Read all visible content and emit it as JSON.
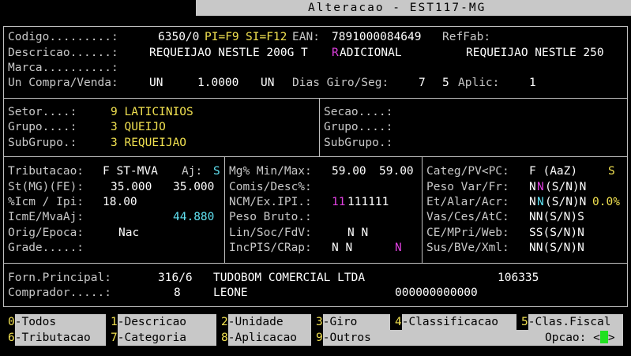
{
  "title": "Alteracao - EST117-MG",
  "main": {
    "codigo_label": "Codigo.........:",
    "codigo_value": "6350/0",
    "pi_label": "PI=F9",
    "si_label": "SI=F12",
    "ean_label": "EAN:",
    "ean_value": "7891000084649",
    "reffab_label": "RefFab:",
    "descricao_label": "Descricao......:",
    "descricao_value_a": "REQUEIJAO NESTLE 200G T",
    "descricao_value_b": "R",
    "descricao_value_c": "ADICIONAL",
    "descricao_short": "REQUEIJAO NESTLE 250",
    "marca_label": "Marca..........:",
    "uncompra_label": "Un Compra/Venda:",
    "un_compra": "UN",
    "fator": "1.0000",
    "un_venda": "UN",
    "diasgiro_label": "Dias Giro/Seg:",
    "diasgiro_value": "7",
    "seg_value": "5",
    "aplic_label": "Aplic:",
    "aplic_value": "1"
  },
  "setor": {
    "setor_label": "Setor....:",
    "setor_value": "9 LATICINIOS",
    "grupo_label": "Grupo....:",
    "grupo_value": "3 QUEIJO",
    "subgrupo_label": "SubGrupo.:",
    "subgrupo_value": "3 REQUEIJAO",
    "secao_label": "Secao....:",
    "grupo2_label": "Grupo....:",
    "subgrupo2_label": "SubGrupo.:"
  },
  "trib": {
    "tributacao_label": "Tributacao:",
    "tributacao_value": "F ST-MVA",
    "aj_label": "Aj:",
    "aj_value": "S",
    "st_label": "St(MG)(FE):",
    "st_value_1": "35.000",
    "st_value_2": "35.000",
    "icm_label": "%Icm / Ipi:",
    "icm_value": "18.00",
    "icme_label": "IcmE/MvaAj:",
    "icme_value": "44.880",
    "orig_label": "Orig/Epoca:",
    "orig_value": "Nac",
    "grade_label": "Grade.....:"
  },
  "margem": {
    "mg_label": "Mg% Min/Max:",
    "mg_min": "59.00",
    "mg_max": "59.00",
    "comis_label": "Comis/Desc%:",
    "ncm_label": "NCM/Ex.IPI.:",
    "ncm_value_a": "11",
    "ncm_value_b": "111111",
    "peso_label": "Peso Bruto.:",
    "lin_label": "Lin/Soc/FdV:",
    "lin_value": "N N",
    "inc_label": "IncPIS/CRap:",
    "inc_value": "N N",
    "inc_value_2": "N"
  },
  "categ": {
    "categ_label": "Categ/PV<PC:",
    "categ_value": "F (AaZ)",
    "categ_flag": "S",
    "pesovar_label": "Peso Var/Fr:",
    "pesovar_a": "N",
    "pesovar_b": "N",
    "pesovar_c": "(S/N)N",
    "et_label": "Et/Alar/Acr:",
    "et_a": "N",
    "et_b": "N",
    "et_c": "(S/N)N",
    "et_pct": "0.0%",
    "vas_label": "Vas/Ces/AtC:",
    "vas_value": "NN(S/N)S",
    "ce_label": "CE/MPri/Web:",
    "ce_value": "SS(S/N)N",
    "sus_label": "Sus/BVe/Xml:",
    "sus_value": "NN(S/N)N"
  },
  "fornecedor": {
    "forn_label": "Forn.Principal:",
    "forn_code": "316/6",
    "forn_name": "TUDOBOM COMERCIAL LTDA",
    "forn_num": "106335",
    "comprador_label": "Comprador.....:",
    "comprador_code": "8",
    "comprador_name": "LEONE",
    "comprador_num": "000000000000"
  },
  "menu": {
    "items": [
      {
        "key": "0",
        "label": "-Todos"
      },
      {
        "key": "1",
        "label": "-Descricao"
      },
      {
        "key": "2",
        "label": "-Unidade"
      },
      {
        "key": "3",
        "label": "-Giro"
      },
      {
        "key": "4",
        "label": "-Classificacao"
      },
      {
        "key": "5",
        "label": "-Clas.Fiscal"
      },
      {
        "key": "6",
        "label": "-Tributacao"
      },
      {
        "key": "7",
        "label": "-Categoria"
      },
      {
        "key": "8",
        "label": "-Aplicacao"
      },
      {
        "key": "9",
        "label": "-Outros"
      }
    ],
    "opcao_label": "Opcao: <",
    "opcao_close": ">"
  }
}
